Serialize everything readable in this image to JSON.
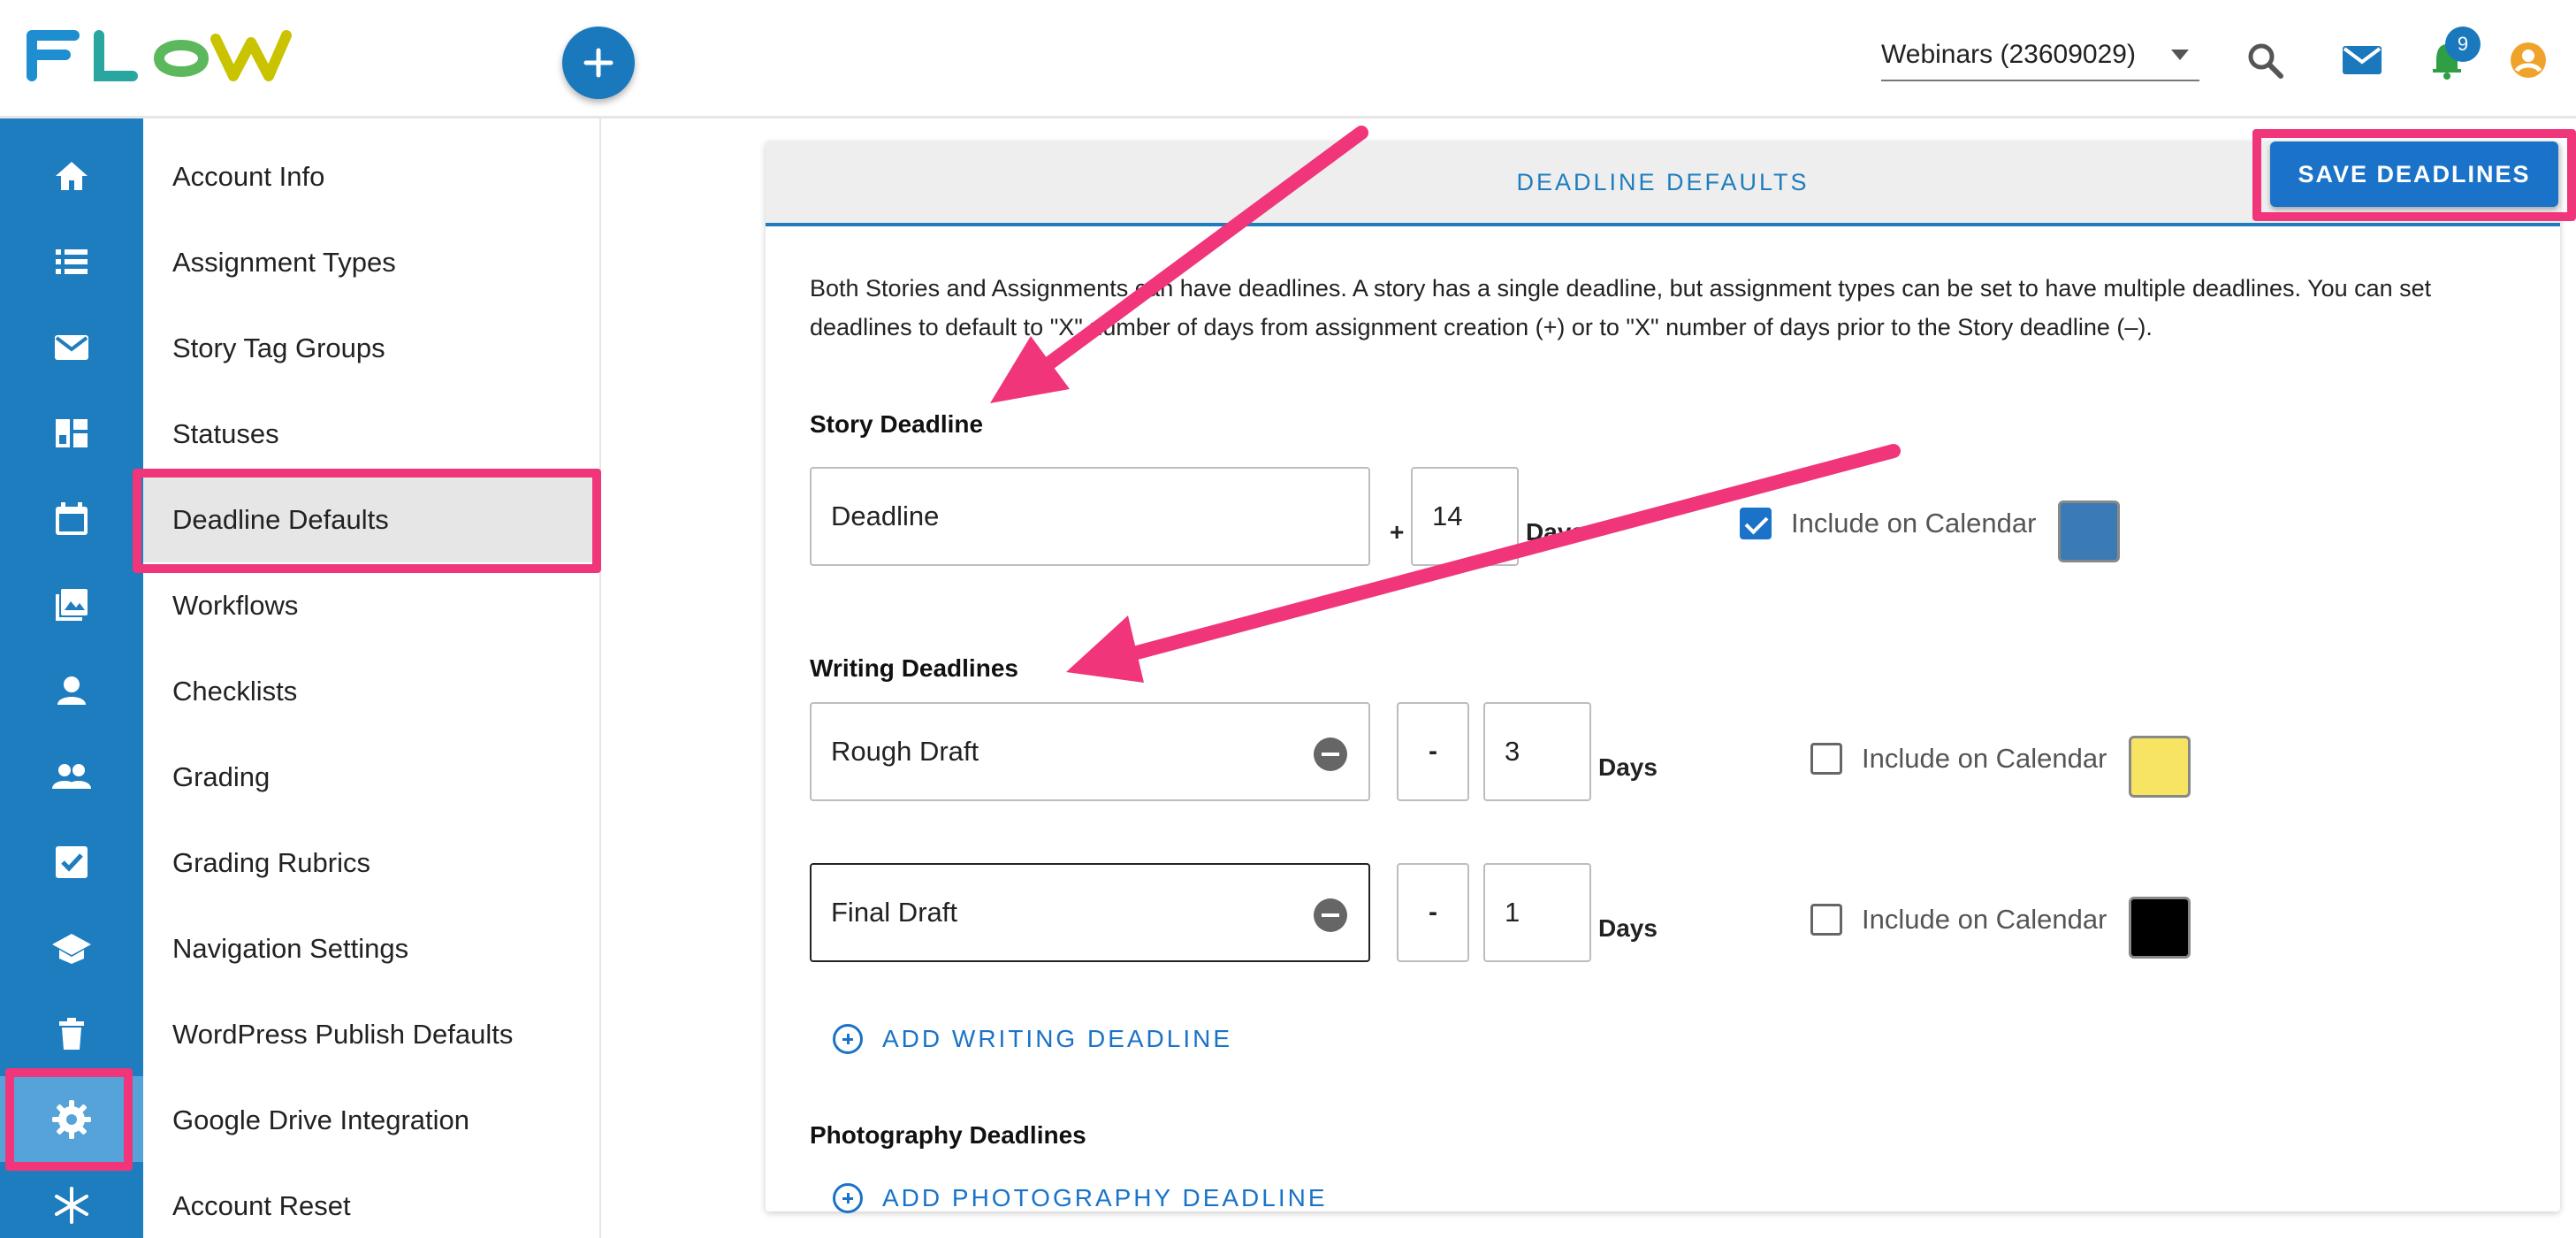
{
  "app": {
    "brand_color": "#1e7dbf",
    "highlight_color": "#f0357a"
  },
  "header": {
    "logo_icon": "flow-logo-icon",
    "add_icon": "plus-icon",
    "org_selector": "Webinars (23609029)",
    "search_icon": "search-icon",
    "mail_icon": "mail-icon",
    "notifications_icon": "bell-icon",
    "notifications_count": "9",
    "account_icon": "account-circle-icon"
  },
  "rail": {
    "items": [
      {
        "icon": "home-icon"
      },
      {
        "icon": "list-icon"
      },
      {
        "icon": "mail-icon"
      },
      {
        "icon": "dashboard-icon"
      },
      {
        "icon": "calendar-icon"
      },
      {
        "icon": "photo-library-icon"
      },
      {
        "icon": "person-icon"
      },
      {
        "icon": "group-icon"
      },
      {
        "icon": "checkbox-icon"
      },
      {
        "icon": "school-icon"
      },
      {
        "icon": "trash-icon"
      },
      {
        "icon": "gear-icon",
        "active": true
      },
      {
        "icon": "snowflake-icon"
      }
    ]
  },
  "sidebar": {
    "items": [
      {
        "label": "Account Info"
      },
      {
        "label": "Assignment Types"
      },
      {
        "label": "Story Tag Groups"
      },
      {
        "label": "Statuses"
      },
      {
        "label": "Deadline Defaults",
        "active": true
      },
      {
        "label": "Workflows"
      },
      {
        "label": "Checklists"
      },
      {
        "label": "Grading"
      },
      {
        "label": "Grading Rubrics"
      },
      {
        "label": "Navigation Settings"
      },
      {
        "label": "WordPress Publish Defaults"
      },
      {
        "label": "Google Drive Integration"
      },
      {
        "label": "Account Reset"
      }
    ]
  },
  "main": {
    "tab_title": "DEADLINE DEFAULTS",
    "save_button": "SAVE DEADLINES",
    "description": "Both Stories and Assignments can have deadlines. A story has a single deadline, but assignment types can be set to have multiple deadlines. You can set deadlines to default to \"X\" number of days from assignment creation (+) or to \"X\" number of days prior to the Story deadline (–).",
    "story_section": {
      "title": "Story Deadline",
      "name": "Deadline",
      "sign": "+",
      "days": "14",
      "days_label": "Days",
      "include_label": "Include on Calendar",
      "include_checked": true,
      "color": "#3a7ab5"
    },
    "writing_section": {
      "title": "Writing Deadlines",
      "rows": [
        {
          "name": "Rough Draft",
          "sign": "-",
          "days": "3",
          "days_label": "Days",
          "include_label": "Include on Calendar",
          "include_checked": false,
          "color": "#f7e463"
        },
        {
          "name": "Final Draft",
          "sign": "-",
          "days": "1",
          "days_label": "Days",
          "include_label": "Include on Calendar",
          "include_checked": false,
          "color": "#000000"
        }
      ],
      "add_label": "ADD WRITING DEADLINE"
    },
    "photography_section": {
      "title": "Photography Deadlines",
      "add_label": "ADD PHOTOGRAPHY DEADLINE"
    }
  }
}
